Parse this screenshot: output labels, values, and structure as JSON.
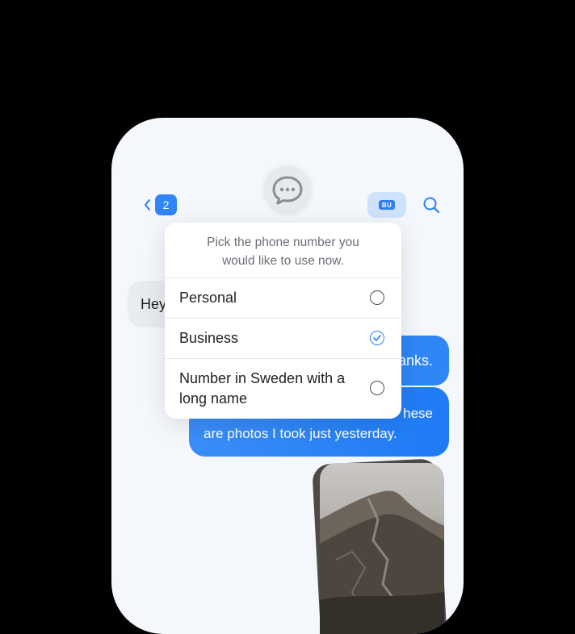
{
  "header": {
    "unread_count": "2",
    "line_chip": "BU"
  },
  "messages": {
    "incoming_1": "Hey",
    "outgoing_1": "anks.",
    "outgoing_2_line1": "hese",
    "outgoing_2_line2": "are photos I took just yesterday."
  },
  "picker": {
    "prompt_line1": "Pick the phone number you",
    "prompt_line2": "would like to use now.",
    "options": [
      {
        "label": "Personal",
        "selected": false
      },
      {
        "label": "Business",
        "selected": true
      },
      {
        "label": "Number in Sweden with a long name",
        "selected": false
      }
    ]
  },
  "colors": {
    "accent": "#2f7ff6",
    "background": "#000000",
    "screen": "#f4f7fc"
  },
  "icons": {
    "back": "chevron-left-icon",
    "avatar": "chat-bubble-icon",
    "search": "search-icon",
    "radio_checked": "check-icon"
  }
}
